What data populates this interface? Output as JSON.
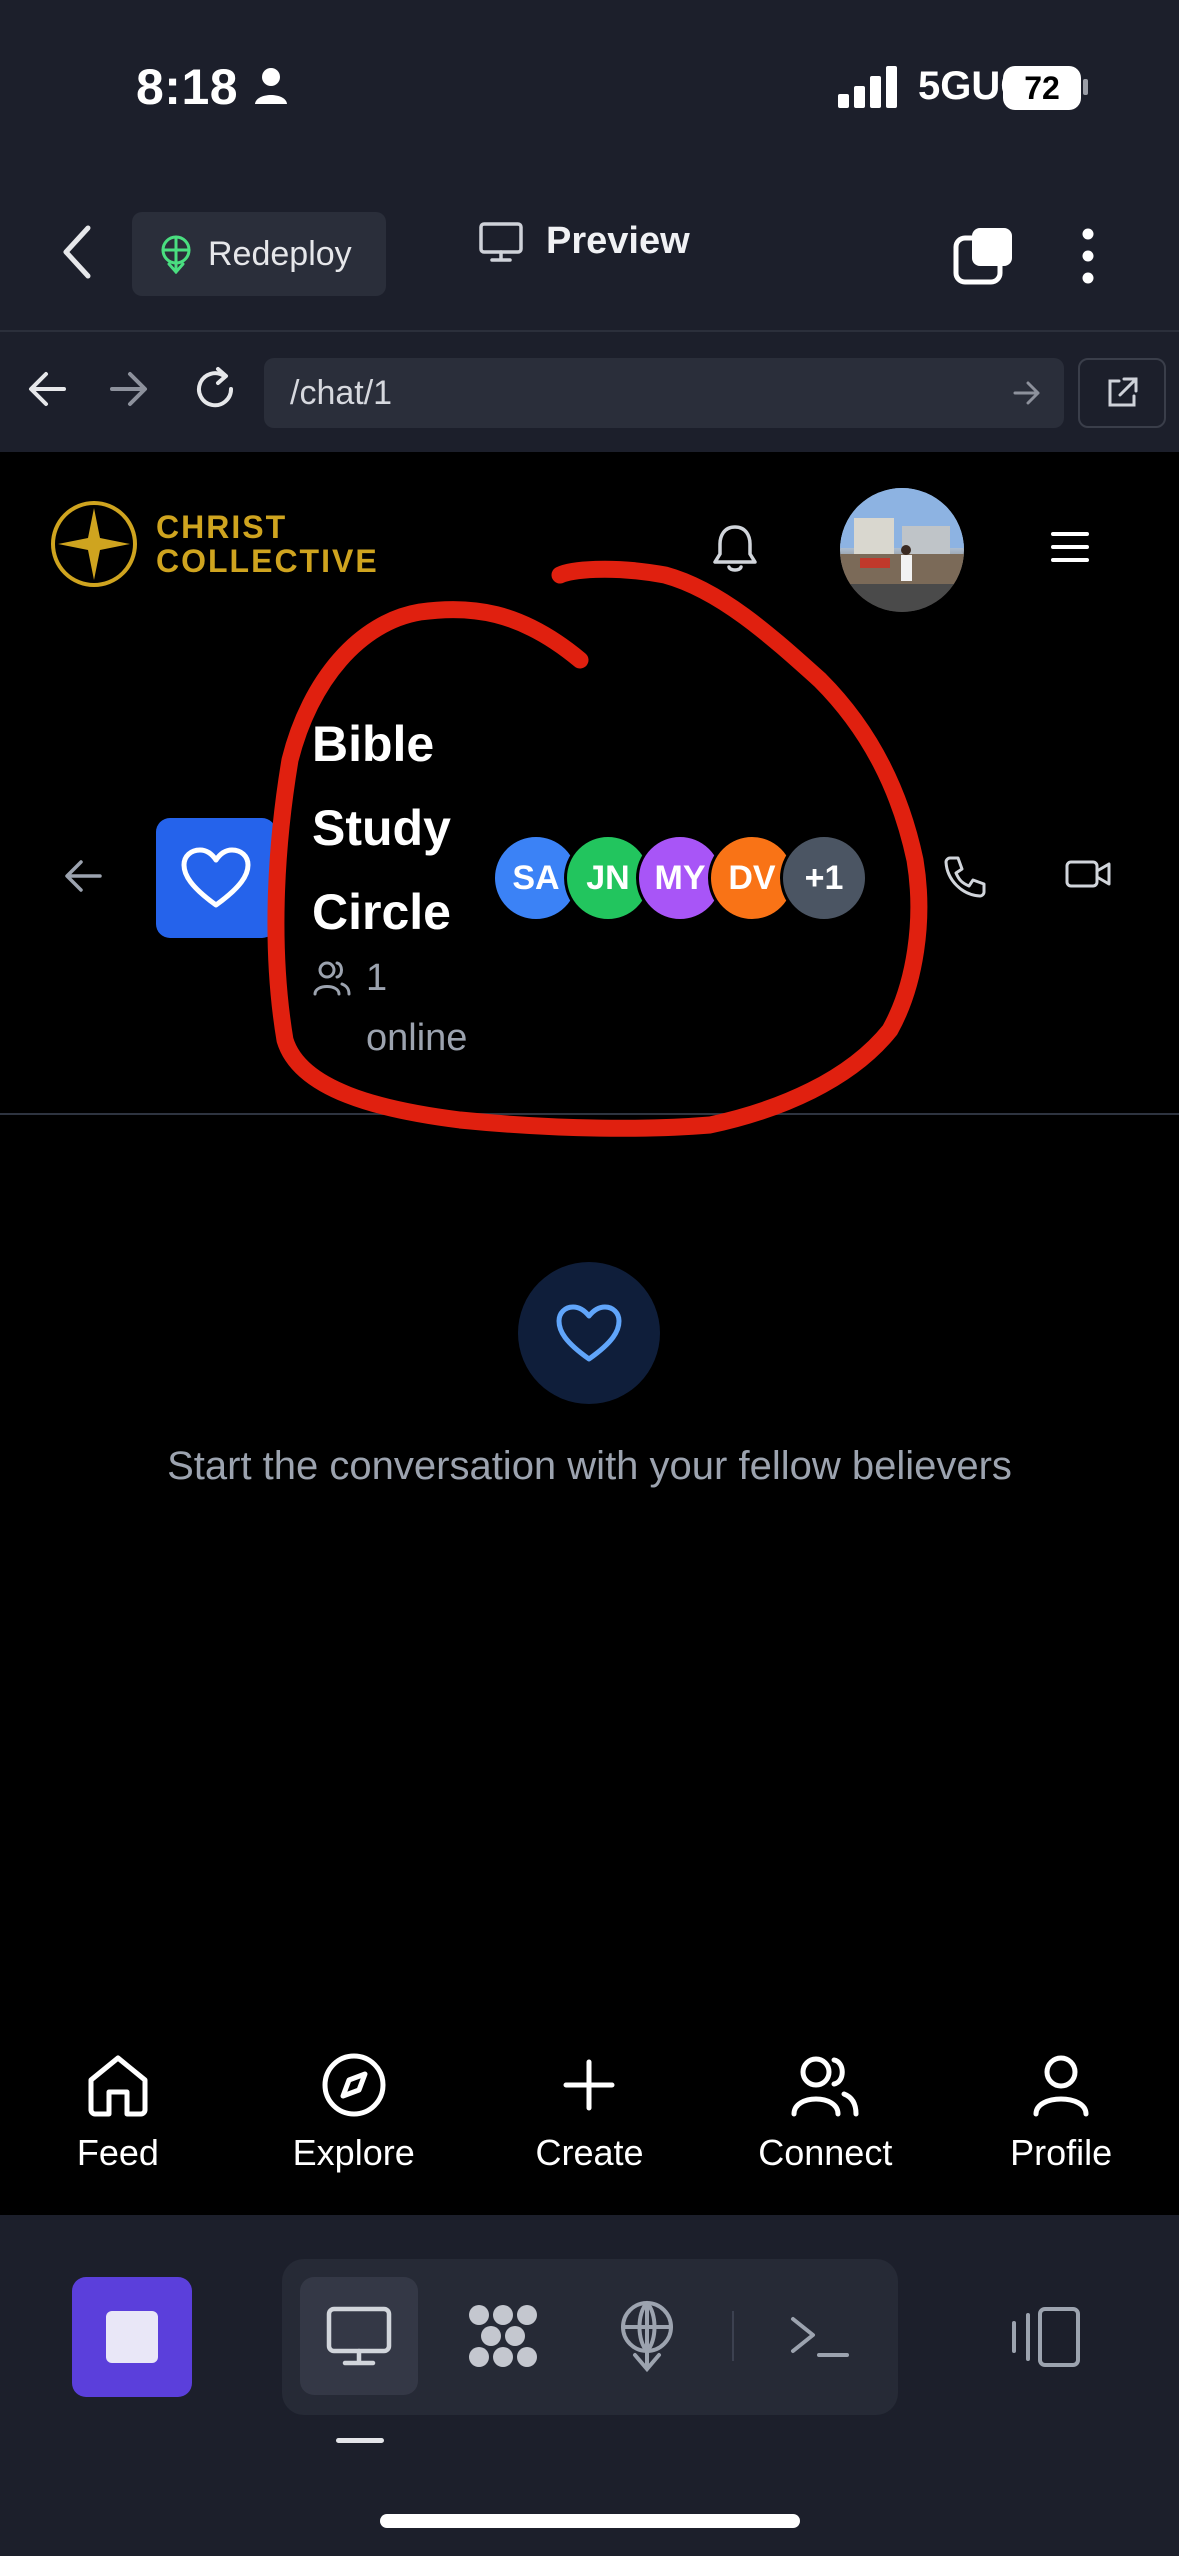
{
  "status_bar": {
    "time": "8:18",
    "network": "5GUC",
    "battery": "72"
  },
  "replit_bar": {
    "redeploy_label": "Redeploy",
    "preview_label": "Preview"
  },
  "url_bar": {
    "url": "/chat/1"
  },
  "app_header": {
    "logo_line1": "CHRIST",
    "logo_line2": "COLLECTIVE",
    "brand_color": "#cfa41f"
  },
  "chat": {
    "title": "Bible Study Circle",
    "online_text": "1 online",
    "members": [
      {
        "initials": "SA",
        "color": "#3b82f6"
      },
      {
        "initials": "JN",
        "color": "#22c55e"
      },
      {
        "initials": "MY",
        "color": "#a855f7"
      },
      {
        "initials": "DV",
        "color": "#f97316"
      },
      {
        "initials": "+1",
        "color": "#4b5563"
      }
    ],
    "empty_message": "Start the conversation with your fellow believers",
    "accent_color": "#2563eb"
  },
  "bottom_nav": {
    "items": [
      {
        "label": "Feed",
        "icon": "home-icon"
      },
      {
        "label": "Explore",
        "icon": "compass-icon"
      },
      {
        "label": "Create",
        "icon": "plus-icon"
      },
      {
        "label": "Connect",
        "icon": "users-icon"
      },
      {
        "label": "Profile",
        "icon": "user-icon"
      }
    ]
  },
  "annotation_color": "#e0200f"
}
